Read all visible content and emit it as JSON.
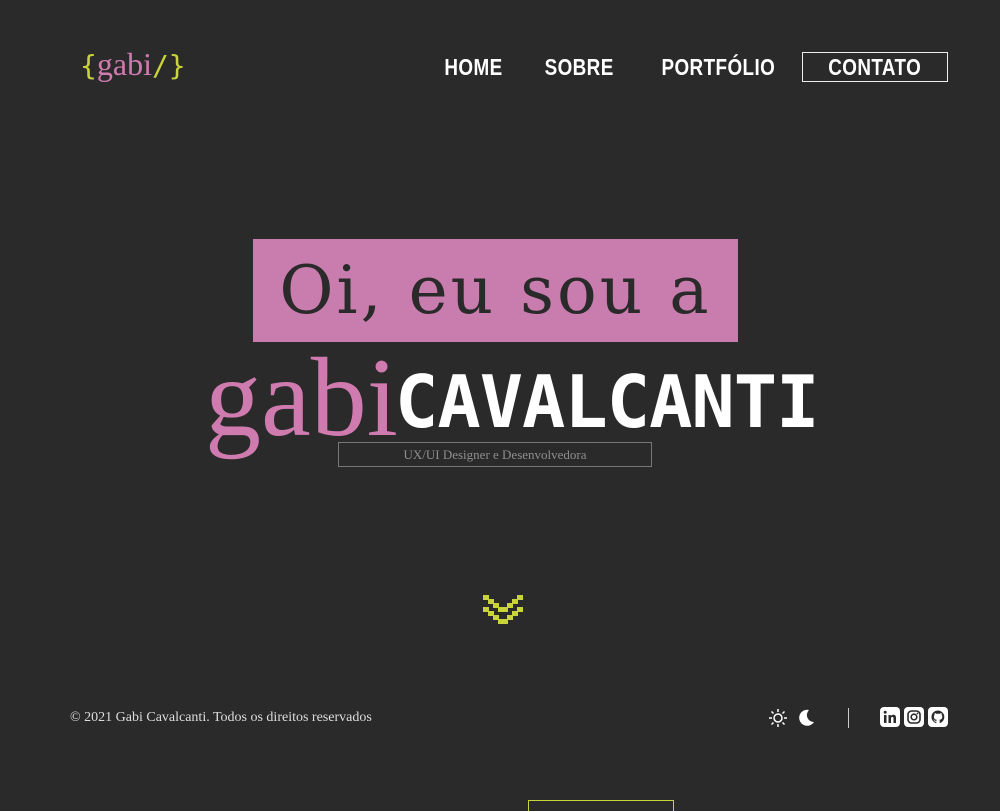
{
  "logo": {
    "open": "{",
    "name": "gabi",
    "close": "/}"
  },
  "nav": {
    "items": [
      "HOME",
      "SOBRE",
      "PORTFÓLIO"
    ],
    "contact": "CONTATO"
  },
  "hero": {
    "greeting": "Oi, eu sou a",
    "first_name": "gabi",
    "last_name": "CAVALCANTI",
    "role": "UX/UI Designer e Desenvolvedora"
  },
  "footer": {
    "copyright": "© 2021 Gabi Cavalcanti. Todos os direitos reservados"
  },
  "icons": {
    "scroll": "chevron-down-icon",
    "light": "sun-icon",
    "dark": "moon-icon",
    "social": [
      "linkedin-icon",
      "instagram-icon",
      "github-icon"
    ]
  },
  "colors": {
    "background": "#2b2a2a",
    "pink": "#c97daf",
    "yellow": "#c9d33a"
  }
}
